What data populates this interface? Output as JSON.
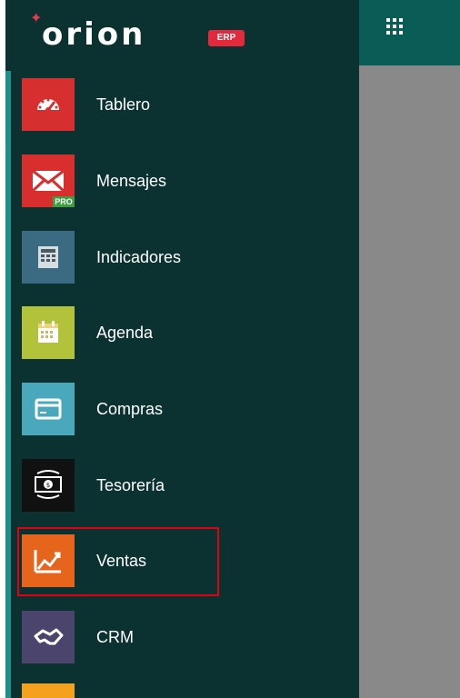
{
  "app": {
    "brand": "orion",
    "brand_badge": "ERP"
  },
  "menu": [
    {
      "key": "tablero",
      "label": "Tablero",
      "icon": "speedometer-icon",
      "color": "#d72f2f"
    },
    {
      "key": "mensajes",
      "label": "Mensajes",
      "icon": "mail-icon",
      "badge": "PRO",
      "color": "#d82e2e"
    },
    {
      "key": "indicadores",
      "label": "Indicadores",
      "icon": "monitor-icon",
      "color": "#3a6b83"
    },
    {
      "key": "agenda",
      "label": "Agenda",
      "icon": "calendar-icon",
      "color": "#b2c23a"
    },
    {
      "key": "compras",
      "label": "Compras",
      "icon": "credit-card-icon",
      "color": "#4aa8bc"
    },
    {
      "key": "tesoreria",
      "label": "Tesorería",
      "icon": "cash-icon",
      "color": "#111111"
    },
    {
      "key": "ventas",
      "label": "Ventas",
      "icon": "trend-up-icon",
      "color": "#e7641d",
      "highlighted": true
    },
    {
      "key": "crm",
      "label": "CRM",
      "icon": "handshake-icon",
      "color": "#4b456d"
    }
  ]
}
